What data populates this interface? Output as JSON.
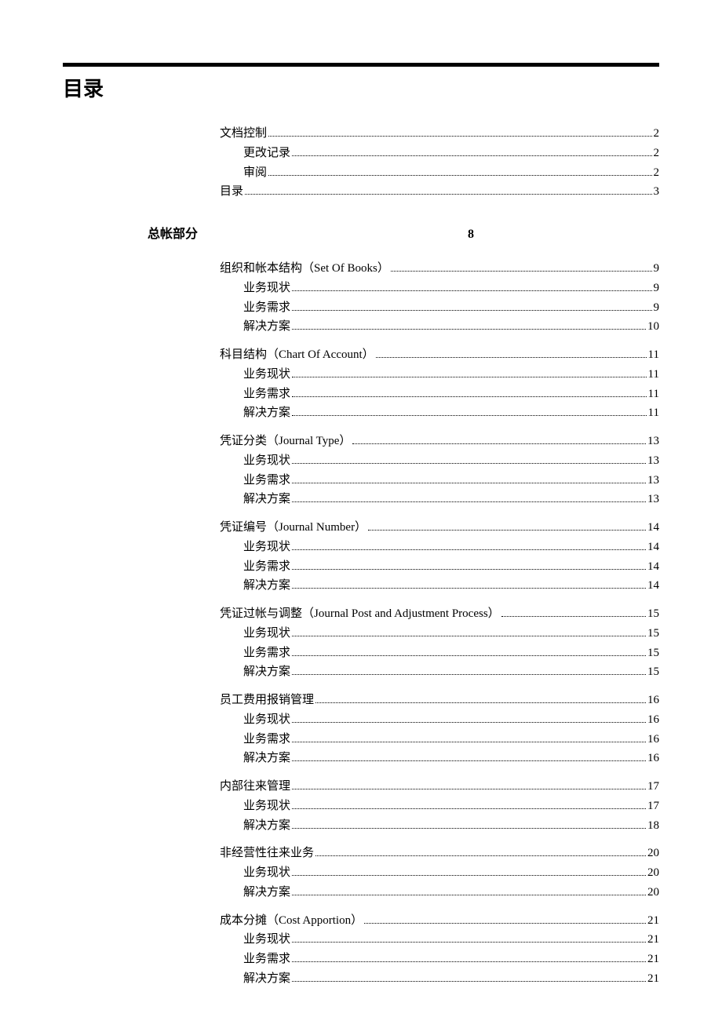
{
  "title": "目录",
  "top_entries": [
    {
      "label": "文档控制",
      "page": "2",
      "indent": 0
    },
    {
      "label": "更改记录",
      "page": "2",
      "indent": 1
    },
    {
      "label": "审阅",
      "page": "2",
      "indent": 1
    },
    {
      "label": "目录",
      "page": "3",
      "indent": 0
    }
  ],
  "section": {
    "label": "总帐部分",
    "page": "8"
  },
  "groups": [
    {
      "head": {
        "label": "组织和帐本结构（Set Of Books）",
        "page": "9"
      },
      "children": [
        {
          "label": "业务现状",
          "page": "9"
        },
        {
          "label": "业务需求",
          "page": "9"
        },
        {
          "label": "解决方案",
          "page": "10"
        }
      ]
    },
    {
      "head": {
        "label": "科目结构（Chart Of Account）",
        "page": "11"
      },
      "children": [
        {
          "label": "业务现状",
          "page": "11"
        },
        {
          "label": "业务需求",
          "page": "11"
        },
        {
          "label": "解决方案",
          "page": "11"
        }
      ]
    },
    {
      "head": {
        "label": "凭证分类（Journal Type）",
        "page": "13"
      },
      "children": [
        {
          "label": "业务现状",
          "page": "13"
        },
        {
          "label": "业务需求",
          "page": "13"
        },
        {
          "label": "解决方案",
          "page": "13"
        }
      ]
    },
    {
      "head": {
        "label": "凭证编号（Journal Number）",
        "page": "14"
      },
      "children": [
        {
          "label": "业务现状",
          "page": "14"
        },
        {
          "label": "业务需求",
          "page": "14"
        },
        {
          "label": "解决方案",
          "page": "14"
        }
      ]
    },
    {
      "head": {
        "label": "凭证过帐与调整（Journal Post and Adjustment Process）",
        "page": "15"
      },
      "children": [
        {
          "label": "业务现状",
          "page": "15"
        },
        {
          "label": "业务需求",
          "page": "15"
        },
        {
          "label": "解决方案",
          "page": "15"
        }
      ]
    },
    {
      "head": {
        "label": "员工费用报销管理",
        "page": "16"
      },
      "children": [
        {
          "label": "业务现状",
          "page": "16"
        },
        {
          "label": "业务需求",
          "page": "16"
        },
        {
          "label": "解决方案",
          "page": "16"
        }
      ]
    },
    {
      "head": {
        "label": "内部往来管理",
        "page": "17"
      },
      "children": [
        {
          "label": "业务现状",
          "page": "17"
        },
        {
          "label": "解决方案",
          "page": "18"
        }
      ]
    },
    {
      "head": {
        "label": "非经营性往来业务",
        "page": "20"
      },
      "children": [
        {
          "label": "业务现状",
          "page": "20"
        },
        {
          "label": "解决方案",
          "page": "20"
        }
      ]
    },
    {
      "head": {
        "label": "成本分摊（Cost Apportion）",
        "page": "21"
      },
      "children": [
        {
          "label": "业务现状",
          "page": "21"
        },
        {
          "label": "业务需求",
          "page": "21"
        },
        {
          "label": "解决方案",
          "page": "21"
        }
      ]
    }
  ]
}
